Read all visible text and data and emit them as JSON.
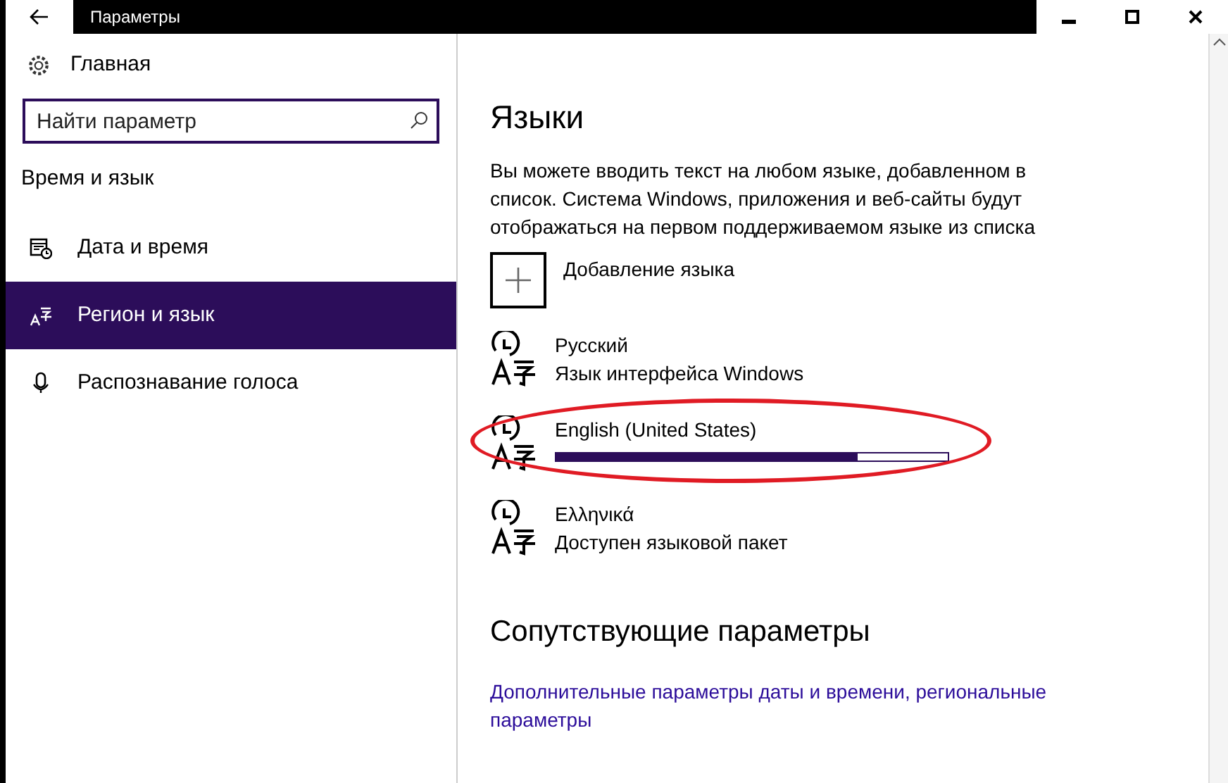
{
  "window": {
    "title": "Параметры"
  },
  "sidebar": {
    "home": "Главная",
    "search": {
      "placeholder": "Найти параметр"
    },
    "section": "Время и язык",
    "items": [
      {
        "label": "Дата и время",
        "kind": "calendar",
        "selected": false
      },
      {
        "label": "Регион и язык",
        "kind": "language",
        "selected": true
      },
      {
        "label": "Распознавание голоса",
        "kind": "mic",
        "selected": false
      }
    ]
  },
  "content": {
    "title": "Языки",
    "description": "Вы можете вводить текст на любом языке, добавленном в список. Система Windows, приложения и веб-сайты будут отображаться на первом поддерживаемом языке из списка",
    "add_language": "Добавление языка",
    "languages": [
      {
        "name": "Русский",
        "kind": "status",
        "status": "Язык интерфейса Windows",
        "highlighted": false
      },
      {
        "name": "English (United States)",
        "kind": "progress",
        "level": 0.77,
        "highlighted": true
      },
      {
        "name": "Ελληνικά",
        "kind": "status",
        "status": "Доступен языковой пакет",
        "highlighted": false
      }
    ],
    "related_title": "Сопутствующие параметры",
    "related_link": "Дополнительные параметры даты и времени, региональные параметры"
  }
}
